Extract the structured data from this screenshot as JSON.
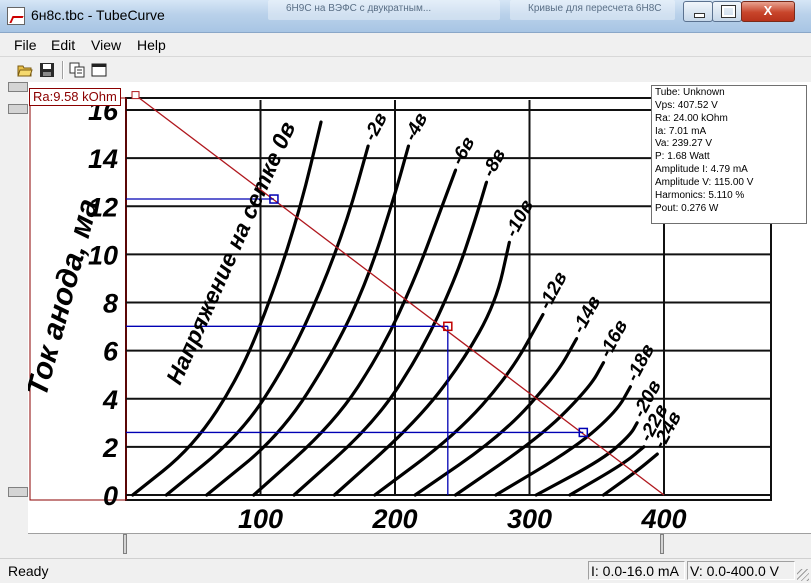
{
  "window": {
    "title": "6н8с.tbc - TubeCurve",
    "background_tab_1": "6Н9С на ВЭФС с двукратным...",
    "background_tab_2": "Кривые для пересчета 6Н8С",
    "minimize_glyph": "",
    "maximize_glyph": "",
    "close_glyph": "X"
  },
  "menu": {
    "file": "File",
    "edit": "Edit",
    "view": "View",
    "help": "Help"
  },
  "toolbar": {
    "icons": [
      "open-folder-icon",
      "save-disk-icon",
      "copy-icon",
      "window-icon"
    ]
  },
  "load_line_label": "Ra:9.58 kOhm",
  "info_panel": [
    "Tube: Unknown",
    "Vps: 407.52 V",
    "Ra: 24.00 kOhm",
    "Ia: 7.01 mA",
    "Va: 239.27 V",
    "P: 1.68 Watt",
    "Amplitude I: 4.79 mA",
    "Amplitude V: 115.00 V",
    "Harmonics: 5.110 %",
    "Pout: 0.276 W"
  ],
  "chart_data": {
    "type": "line",
    "ylabel": "Ток анода, ма",
    "xlabel": "",
    "x_ticks": [
      "100",
      "200",
      "300",
      "400"
    ],
    "y_ticks": [
      "0",
      "2",
      "4",
      "6",
      "8",
      "10",
      "12",
      "14",
      "16"
    ],
    "xlim": [
      0,
      400
    ],
    "ylim": [
      0,
      16
    ],
    "curve_annotation": "Напряжение на сетке 0в",
    "series": [
      {
        "name": "0в",
        "points": [
          [
            5,
            0
          ],
          [
            50,
            2
          ],
          [
            85,
            5
          ],
          [
            110,
            8.5
          ],
          [
            130,
            12
          ],
          [
            145,
            15.5
          ]
        ]
      },
      {
        "name": "-2в",
        "points": [
          [
            30,
            0
          ],
          [
            85,
            2.5
          ],
          [
            120,
            5.5
          ],
          [
            145,
            8.5
          ],
          [
            165,
            11.5
          ],
          [
            180,
            14.5
          ]
        ]
      },
      {
        "name": "-4в",
        "points": [
          [
            60,
            0
          ],
          [
            115,
            2.5
          ],
          [
            155,
            6
          ],
          [
            180,
            9
          ],
          [
            200,
            12.5
          ],
          [
            210,
            14.5
          ]
        ]
      },
      {
        "name": "-6в",
        "points": [
          [
            95,
            0
          ],
          [
            155,
            3
          ],
          [
            190,
            6
          ],
          [
            215,
            9
          ],
          [
            235,
            12
          ],
          [
            245,
            13.5
          ]
        ]
      },
      {
        "name": "-8в",
        "points": [
          [
            125,
            0
          ],
          [
            185,
            3
          ],
          [
            220,
            6
          ],
          [
            245,
            9
          ],
          [
            260,
            11.5
          ],
          [
            268,
            13
          ]
        ]
      },
      {
        "name": "-10в",
        "points": [
          [
            155,
            0
          ],
          [
            215,
            3
          ],
          [
            250,
            5.5
          ],
          [
            275,
            8
          ],
          [
            285,
            10.5
          ]
        ]
      },
      {
        "name": "-12в",
        "points": [
          [
            185,
            0
          ],
          [
            245,
            2.5
          ],
          [
            285,
            5
          ],
          [
            310,
            7.5
          ]
        ]
      },
      {
        "name": "-14в",
        "points": [
          [
            215,
            0
          ],
          [
            280,
            2.5
          ],
          [
            320,
            5
          ],
          [
            335,
            6.5
          ]
        ]
      },
      {
        "name": "-16в",
        "points": [
          [
            245,
            0
          ],
          [
            310,
            2.5
          ],
          [
            345,
            4.5
          ],
          [
            355,
            5.5
          ]
        ]
      },
      {
        "name": "-18в",
        "points": [
          [
            275,
            0
          ],
          [
            335,
            2
          ],
          [
            365,
            3.5
          ],
          [
            375,
            4.5
          ]
        ]
      },
      {
        "name": "-20в",
        "points": [
          [
            305,
            0
          ],
          [
            355,
            1.5
          ],
          [
            375,
            2.5
          ],
          [
            380,
            3
          ]
        ]
      },
      {
        "name": "-22в",
        "points": [
          [
            330,
            0
          ],
          [
            370,
            1.3
          ],
          [
            385,
            2
          ]
        ]
      },
      {
        "name": "-24в",
        "points": [
          [
            355,
            0
          ],
          [
            380,
            1
          ],
          [
            395,
            1.7
          ]
        ]
      }
    ],
    "load_line": {
      "from": [
        0,
        16.1
      ],
      "to": [
        400,
        0
      ]
    },
    "operating_point": {
      "va": 239.27,
      "ia": 7.01
    },
    "swing_high": {
      "va": 110,
      "ia": 12.3
    },
    "swing_low": {
      "va": 340,
      "ia": 2.6
    }
  },
  "status": {
    "ready": "Ready",
    "current_range": "I: 0.0-16.0 mA",
    "voltage_range": "V: 0.0-400.0 V"
  }
}
